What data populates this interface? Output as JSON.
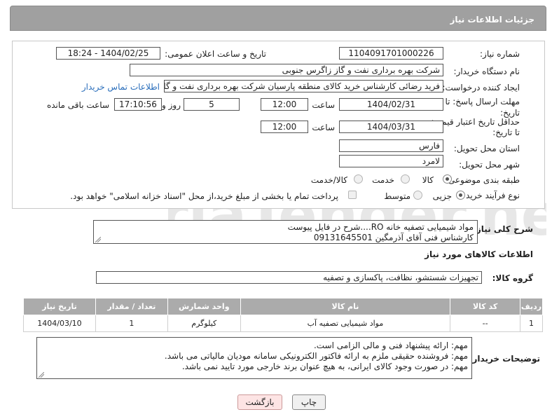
{
  "header": {
    "title": "جزئیات اطلاعات نیاز"
  },
  "fields": {
    "need_number_label": "شماره نیاز:",
    "need_number": "1104091701000226",
    "announce_label": "تاریخ و ساعت اعلان عمومی:",
    "announce_value": "1404/02/25 - 18:24",
    "buyer_org_label": "نام دستگاه خریدار:",
    "buyer_org": "شرکت بهره برداری نفت و گاز زاگرس جنوبی",
    "requester_label": "ایجاد کننده درخواست:",
    "requester": "فرید رضائی کارشناس خرید کالای منطقه پارسیان شرکت بهره برداری نفت و گاز",
    "contact_link": "اطلاعات تماس خریدار",
    "deadline_label_1": "مهلت ارسال پاسخ: تا",
    "deadline_label_2": "تاریخ:",
    "deadline_date": "1404/02/31",
    "time_label": "ساعت",
    "deadline_time": "12:00",
    "days_value": "5",
    "days_label": "روز و",
    "remaining_time": "17:10:56",
    "remaining_label": "ساعت باقی مانده",
    "price_label_1": "حداقل تاریخ اعتبار قیمت:",
    "price_label_2": "تا تاریخ:",
    "price_date": "1404/03/31",
    "price_time": "12:00",
    "province_label": "استان محل تحویل:",
    "province": "فارس",
    "city_label": "شهر محل تحویل:",
    "city": "لامرد",
    "category_label": "طبقه بندی موضوعی:",
    "category_options": [
      "کالا",
      "خدمت",
      "کالا/خدمت"
    ],
    "purchase_type_label": "نوع فرآیند خرید :",
    "purchase_options": [
      "جزیی",
      "متوسط"
    ],
    "payment_note": "پرداخت تمام یا بخشی از مبلغ خرید،از محل \"اسناد خزانه اسلامی\" خواهد بود."
  },
  "description": {
    "label": "شرح کلی نیاز:",
    "lines": [
      "مواد شیمیایی تصفیه خانه RO....شرح در فایل پیوست",
      "کارشناس فنی آقای آذرمگین 09131645501"
    ]
  },
  "goods": {
    "section_title": "اطلاعات کالاهای مورد نیاز",
    "group_label": "گروه کالا:",
    "group_value": "تجهیزات شستشو، نظافت، پاکسازی و تصفیه",
    "columns": [
      "ردیف",
      "کد کالا",
      "نام کالا",
      "واحد شمارش",
      "تعداد / مقدار",
      "تاریخ نیاز"
    ],
    "rows": [
      [
        "1",
        "--",
        "مواد شیمیایی تصفیه آب",
        "کیلوگرم",
        "1",
        "1404/03/10"
      ]
    ]
  },
  "buyer_notes": {
    "label": "توضیحات خریدار:",
    "lines": [
      "مهم: ارائه پیشنهاد فنی و مالی الزامی است.",
      "مهم: فروشنده حقیقی ملزم به ارائه فاکتور الکترونیکی سامانه مودیان مالیاتی می باشد.",
      "مهم: در صورت وجود کالای ایرانی، به هیچ عنوان برند خارجی مورد تایید نمی باشد."
    ]
  },
  "buttons": {
    "print": "چاپ",
    "back": "بازگشت"
  },
  "watermark": {
    "text": "AriaTender.neT"
  }
}
